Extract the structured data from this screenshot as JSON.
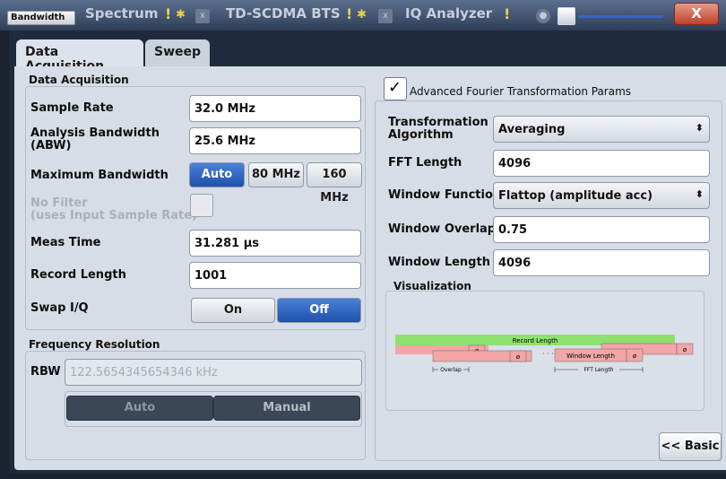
{
  "titlebar": {
    "badge": "Bandwidth",
    "tabs": [
      "Spectrum",
      "TD-SCDMA BTS",
      "IQ Analyzer"
    ],
    "close_label": "X"
  },
  "tabs": [
    {
      "label": "Data Acquisition",
      "active": true
    },
    {
      "label": "Sweep",
      "active": false
    }
  ],
  "data_acquisition": {
    "title": "Data Acquisition",
    "sample_rate_label": "Sample Rate",
    "sample_rate_value": "32.0 MHz",
    "abw_label_1": "Analysis Bandwidth",
    "abw_label_2": "(ABW)",
    "abw_value": "25.6 MHz",
    "max_bw_label": "Maximum Bandwidth",
    "max_bw_options": [
      "Auto",
      "80 MHz",
      "160 MHz"
    ],
    "max_bw_selected": "Auto",
    "no_filter_label_1": "No Filter",
    "no_filter_label_2": "(uses Input Sample Rate)",
    "no_filter_checked": false,
    "meas_time_label": "Meas Time",
    "meas_time_value": "31.281 µs",
    "record_length_label": "Record Length",
    "record_length_value": "1001",
    "swap_iq_label": "Swap I/Q",
    "swap_iq_options": [
      "On",
      "Off"
    ],
    "swap_iq_selected": "Off"
  },
  "frequency_resolution": {
    "title": "Frequency Resolution",
    "rbw_label": "RBW",
    "rbw_value": "122.5654345654346 kHz",
    "rbw_modes": [
      "Auto",
      "Manual"
    ]
  },
  "advanced_fft": {
    "checkbox_label": "Advanced Fourier Transformation Params",
    "checked": true,
    "transformation_label_1": "Transformation",
    "transformation_label_2": "Algorithm",
    "transformation_value": "Averaging",
    "fft_length_label": "FFT Length",
    "fft_length_value": "4096",
    "window_function_label": "Window Function",
    "window_function_value": "Flattop (amplitude acc)",
    "window_overlap_label": "Window Overlap",
    "window_overlap_value": "0.75",
    "window_length_label": "Window Length",
    "window_length_value": "4096"
  },
  "visualization": {
    "title": "Visualization",
    "record_length_label": "Record Length",
    "window_length_label": "Window Length",
    "overlap_label": "Overlap",
    "fft_length_label": "FFT Length",
    "phi_symbol": "ø",
    "dots": "· · · ·",
    "colors": {
      "record": "#8ee06f",
      "window": "#f2a6a6"
    }
  },
  "basic_button": "<< Basic"
}
